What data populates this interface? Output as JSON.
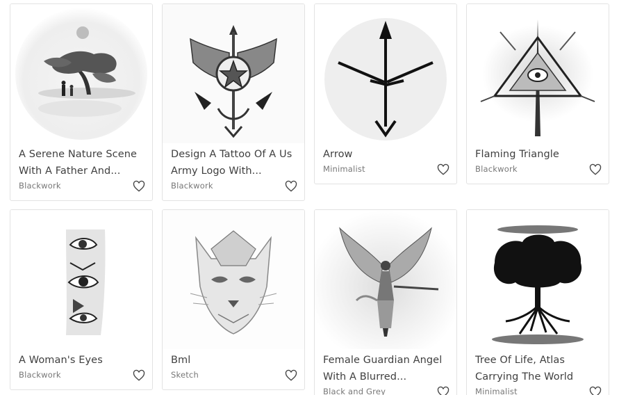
{
  "gallery": {
    "items": [
      {
        "title_line1": "A Serene Nature Scene",
        "title_line2": "With A Father And...",
        "style": "Blackwork"
      },
      {
        "title_line1": "Design A Tattoo Of A Us",
        "title_line2": "Army Logo With...",
        "style": "Blackwork"
      },
      {
        "title_line1": "Arrow",
        "title_line2": "",
        "style": "Minimalist"
      },
      {
        "title_line1": "Flaming Triangle",
        "title_line2": "",
        "style": "Blackwork"
      },
      {
        "title_line1": "A Woman's Eyes",
        "title_line2": "",
        "style": "Blackwork"
      },
      {
        "title_line1": "Bml",
        "title_line2": "",
        "style": "Sketch"
      },
      {
        "title_line1": "Female Guardian Angel",
        "title_line2": "With A Blurred...",
        "style": "Black and Grey"
      },
      {
        "title_line1": "Tree Of Life, Atlas",
        "title_line2": "Carrying The World",
        "style": "Minimalist"
      }
    ],
    "favorite_icon": "heart-outline-icon",
    "colors": {
      "title": "#3f3f3f",
      "style_tag": "#777777",
      "border": "#e2e2e2"
    }
  }
}
